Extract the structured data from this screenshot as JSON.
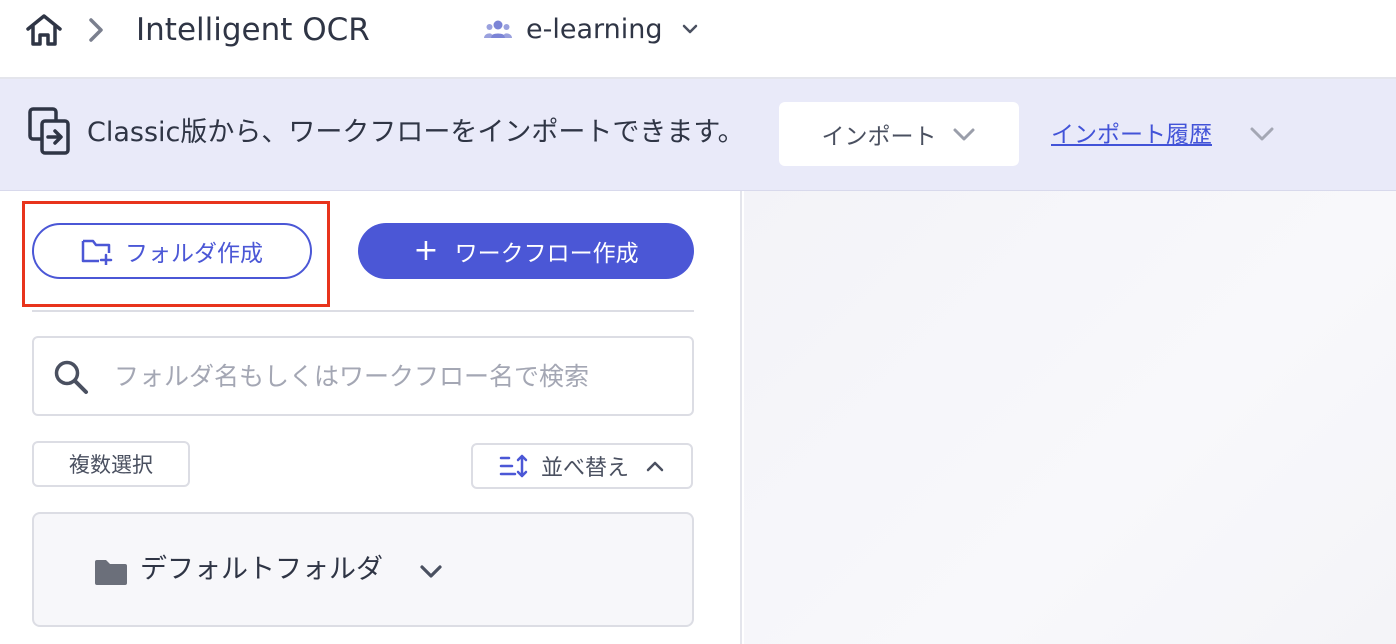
{
  "header": {
    "home_icon": "home-icon",
    "separator_icon": "chevron-right-icon",
    "app_title": "Intelligent OCR",
    "workspace": {
      "icon": "users-icon",
      "name": "e-learning",
      "dropdown_icon": "chevron-down-icon"
    }
  },
  "banner": {
    "icon": "import-icon",
    "message": "Classic版から、ワークフローをインポートできます。",
    "import_button_label": "インポート",
    "history_link_label": "インポート履歴"
  },
  "toolbar": {
    "folder_create_label": "フォルダ作成",
    "workflow_create_label": "ワークフロー作成",
    "workflow_create_icon": "+"
  },
  "search": {
    "placeholder": "フォルダ名もしくはワークフロー名で検索",
    "value": ""
  },
  "list_controls": {
    "multi_select_label": "複数選択",
    "sort_label": "並べ替え"
  },
  "folders": [
    {
      "name": "デフォルトフォルダ",
      "icon": "folder-icon"
    }
  ],
  "colors": {
    "accent": "#4b57d6",
    "banner_bg": "#e9eaf9",
    "highlight": "#e8341c",
    "link": "#4253d8"
  }
}
